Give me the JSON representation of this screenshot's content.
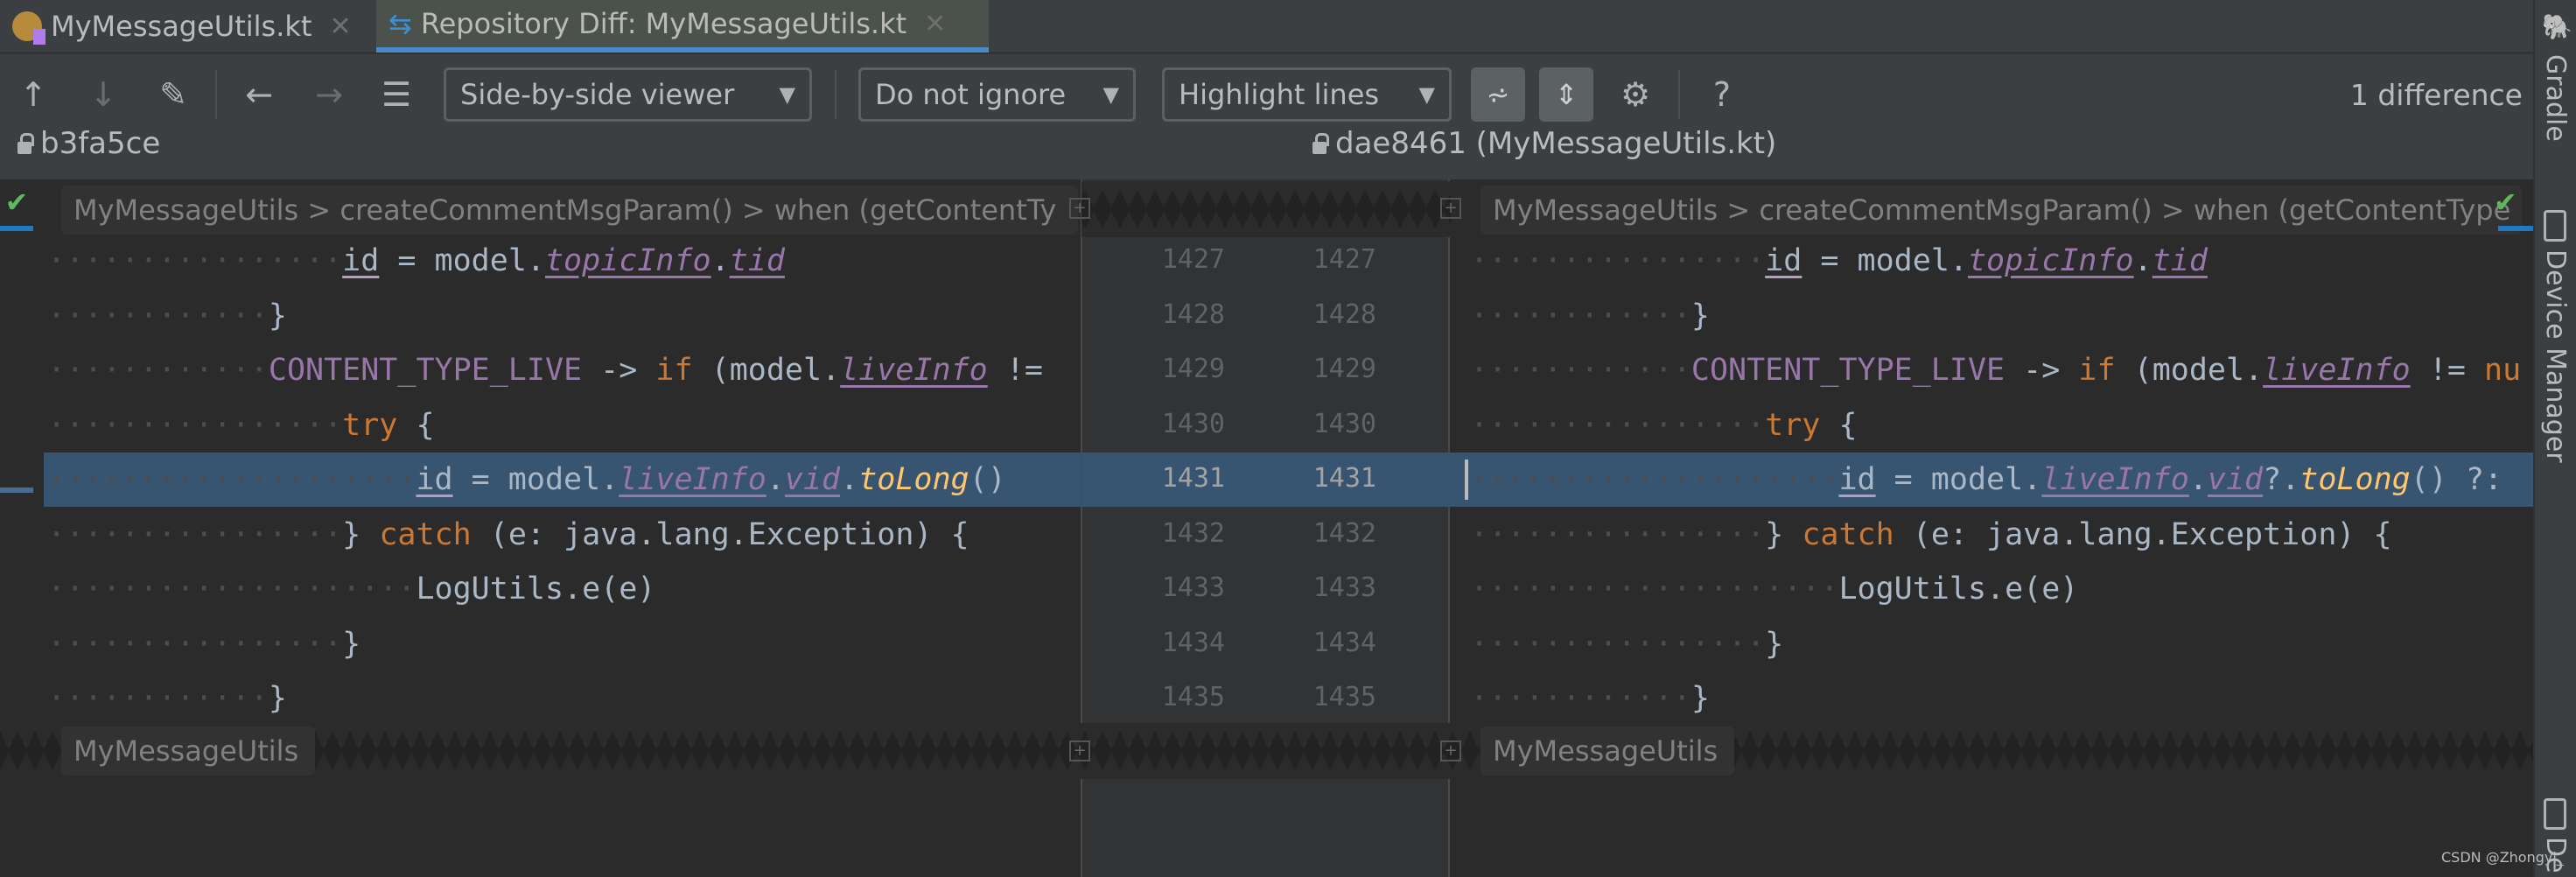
{
  "tabs": [
    {
      "label": "MyMessageUtils.kt",
      "icon": "kotlin-file-icon",
      "active": false
    },
    {
      "label": "Repository Diff: MyMessageUtils.kt",
      "icon": "diff-icon",
      "active": true
    }
  ],
  "toolbar": {
    "viewer": "Side-by-side viewer",
    "ignore": "Do not ignore",
    "highlight": "Highlight lines",
    "help": "?",
    "difference_count": "1 difference"
  },
  "left": {
    "revision": "b3fa5ce",
    "breadcrumb": "MyMessageUtils > createCommentMsgParam() > when (getContentTy",
    "fold_label": "MyMessageUtils"
  },
  "right": {
    "revision": "dae8461 (MyMessageUtils.kt)",
    "breadcrumb": "MyMessageUtils > createCommentMsgParam() > when (getContentType",
    "fold_label": "MyMessageUtils"
  },
  "sidebar": {
    "gradle": "Gradle",
    "device_manager": "Device Manager",
    "device_short": "De"
  },
  "watermark": "CSDN @Zhongyi_",
  "colors": {
    "highlight": "#375470",
    "keyword": "#cc7832",
    "property": "#9876aa",
    "function": "#ffc66d",
    "text": "#a9b7c6",
    "accent": "#4a88c7"
  },
  "lines": [
    {
      "left_no": "1427",
      "right_no": "1427",
      "indent": 16,
      "left": [
        {
          "t": "id",
          "c": "var"
        },
        {
          "t": " = model.",
          "c": "plain"
        },
        {
          "t": "topicInfo",
          "c": "prop"
        },
        {
          "t": ".",
          "c": "plain"
        },
        {
          "t": "tid",
          "c": "prop"
        }
      ],
      "right": [
        {
          "t": "id",
          "c": "var"
        },
        {
          "t": " = model.",
          "c": "plain"
        },
        {
          "t": "topicInfo",
          "c": "prop"
        },
        {
          "t": ".",
          "c": "plain"
        },
        {
          "t": "tid",
          "c": "prop"
        }
      ]
    },
    {
      "left_no": "1428",
      "right_no": "1428",
      "indent": 12,
      "left": [
        {
          "t": "}",
          "c": "plain"
        }
      ],
      "right": [
        {
          "t": "}",
          "c": "plain"
        }
      ]
    },
    {
      "left_no": "1429",
      "right_no": "1429",
      "indent": 12,
      "left": [
        {
          "t": "CONTENT_TYPE_LIVE",
          "c": "const"
        },
        {
          "t": " -> ",
          "c": "plain"
        },
        {
          "t": "if",
          "c": "kw"
        },
        {
          "t": " (model.",
          "c": "plain"
        },
        {
          "t": "liveInfo",
          "c": "prop"
        },
        {
          "t": " !=",
          "c": "plain"
        }
      ],
      "right": [
        {
          "t": "CONTENT_TYPE_LIVE",
          "c": "const"
        },
        {
          "t": " -> ",
          "c": "plain"
        },
        {
          "t": "if",
          "c": "kw"
        },
        {
          "t": " (model.",
          "c": "plain"
        },
        {
          "t": "liveInfo",
          "c": "prop"
        },
        {
          "t": " != ",
          "c": "plain"
        },
        {
          "t": "nu",
          "c": "kw"
        }
      ]
    },
    {
      "left_no": "1430",
      "right_no": "1430",
      "indent": 16,
      "left": [
        {
          "t": "try",
          "c": "kw"
        },
        {
          "t": " {",
          "c": "plain"
        }
      ],
      "right": [
        {
          "t": "try",
          "c": "kw"
        },
        {
          "t": " {",
          "c": "plain"
        }
      ]
    },
    {
      "left_no": "1431",
      "right_no": "1431",
      "indent": 20,
      "changed": true,
      "left": [
        {
          "t": "id",
          "c": "var"
        },
        {
          "t": " = model.",
          "c": "plain"
        },
        {
          "t": "liveInfo",
          "c": "prop"
        },
        {
          "t": ".",
          "c": "plain"
        },
        {
          "t": "vid",
          "c": "prop"
        },
        {
          "t": ".",
          "c": "plain"
        },
        {
          "t": "toLong",
          "c": "fn"
        },
        {
          "t": "()",
          "c": "plain"
        }
      ],
      "right": [
        {
          "t": "id",
          "c": "var"
        },
        {
          "t": " = model.",
          "c": "plain"
        },
        {
          "t": "liveInfo",
          "c": "prop"
        },
        {
          "t": ".",
          "c": "plain"
        },
        {
          "t": "vid",
          "c": "prop"
        },
        {
          "t": "?.",
          "c": "plain"
        },
        {
          "t": "toLong",
          "c": "fn"
        },
        {
          "t": "() ?:",
          "c": "plain"
        }
      ]
    },
    {
      "left_no": "1432",
      "right_no": "1432",
      "indent": 16,
      "left": [
        {
          "t": "} ",
          "c": "plain"
        },
        {
          "t": "catch",
          "c": "kw"
        },
        {
          "t": " (e: java.lang.Exception) {",
          "c": "plain"
        }
      ],
      "right": [
        {
          "t": "} ",
          "c": "plain"
        },
        {
          "t": "catch",
          "c": "kw"
        },
        {
          "t": " (e: java.lang.Exception) {",
          "c": "plain"
        }
      ]
    },
    {
      "left_no": "1433",
      "right_no": "1433",
      "indent": 20,
      "left": [
        {
          "t": "LogUtils.e(e)",
          "c": "plain"
        }
      ],
      "right": [
        {
          "t": "LogUtils.e(e)",
          "c": "plain"
        }
      ]
    },
    {
      "left_no": "1434",
      "right_no": "1434",
      "indent": 16,
      "left": [
        {
          "t": "}",
          "c": "plain"
        }
      ],
      "right": [
        {
          "t": "}",
          "c": "plain"
        }
      ]
    },
    {
      "left_no": "1435",
      "right_no": "1435",
      "indent": 12,
      "left": [
        {
          "t": "}",
          "c": "plain"
        }
      ],
      "right": [
        {
          "t": "}",
          "c": "plain"
        }
      ]
    }
  ]
}
